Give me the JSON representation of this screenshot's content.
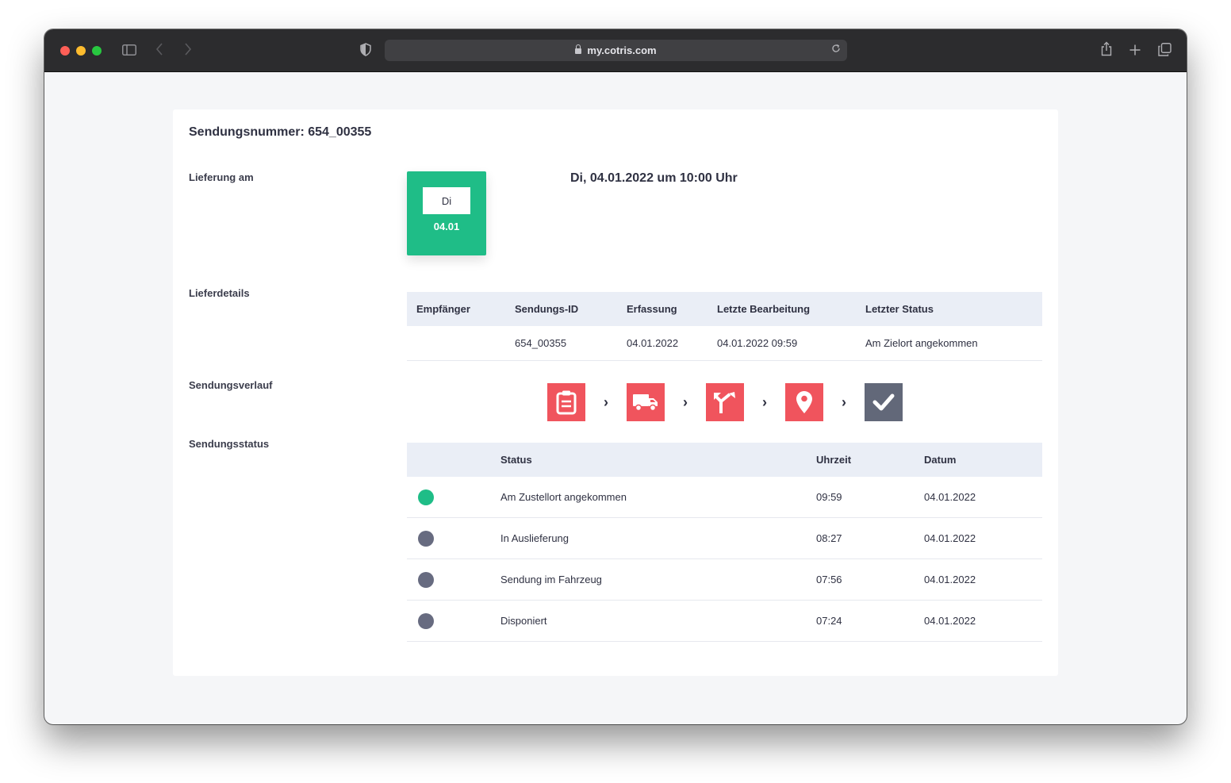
{
  "browser": {
    "url": "my.cotris.com"
  },
  "page": {
    "heading": "Sendungsnummer: 654_00355",
    "labels": {
      "delivery": "Lieferung am",
      "details": "Lieferdetails",
      "history": "Sendungsverlauf",
      "status": "Sendungsstatus"
    },
    "date_tile": {
      "weekday": "Di",
      "date": "04.01"
    },
    "delivery_text": "Di, 04.01.2022 um 10:00 Uhr"
  },
  "details_table": {
    "headers": [
      "Empfänger",
      "Sendungs-ID",
      "Erfassung",
      "Letzte Bearbeitung",
      "Letzter Status"
    ],
    "row": [
      "",
      "654_00355",
      "04.01.2022",
      "04.01.2022 09:59",
      "Am Zielort angekommen"
    ]
  },
  "steps": [
    {
      "icon": "clipboard-icon",
      "state": "done",
      "color": "#f0545d"
    },
    {
      "icon": "truck-icon",
      "state": "done",
      "color": "#f0545d"
    },
    {
      "icon": "route-split-icon",
      "state": "done",
      "color": "#f0545d"
    },
    {
      "icon": "location-pin-icon",
      "state": "done",
      "color": "#f0545d"
    },
    {
      "icon": "checkmark-icon",
      "state": "pending",
      "color": "#626879"
    }
  ],
  "status_table": {
    "headers": [
      "",
      "Status",
      "Uhrzeit",
      "Datum"
    ],
    "rows": [
      {
        "dot": "green",
        "status": "Am Zustellort angekommen",
        "time": "09:59",
        "date": "04.01.2022"
      },
      {
        "dot": "grey",
        "status": "In Auslieferung",
        "time": "08:27",
        "date": "04.01.2022"
      },
      {
        "dot": "grey",
        "status": "Sendung im Fahrzeug",
        "time": "07:56",
        "date": "04.01.2022"
      },
      {
        "dot": "grey",
        "status": "Disponiert",
        "time": "07:24",
        "date": "04.01.2022"
      }
    ]
  },
  "colors": {
    "accent_green": "#1fbd87",
    "step_red": "#f0545d",
    "step_grey": "#626879",
    "dot_grey": "#676b80",
    "table_header_bg": "#eaeef6"
  }
}
